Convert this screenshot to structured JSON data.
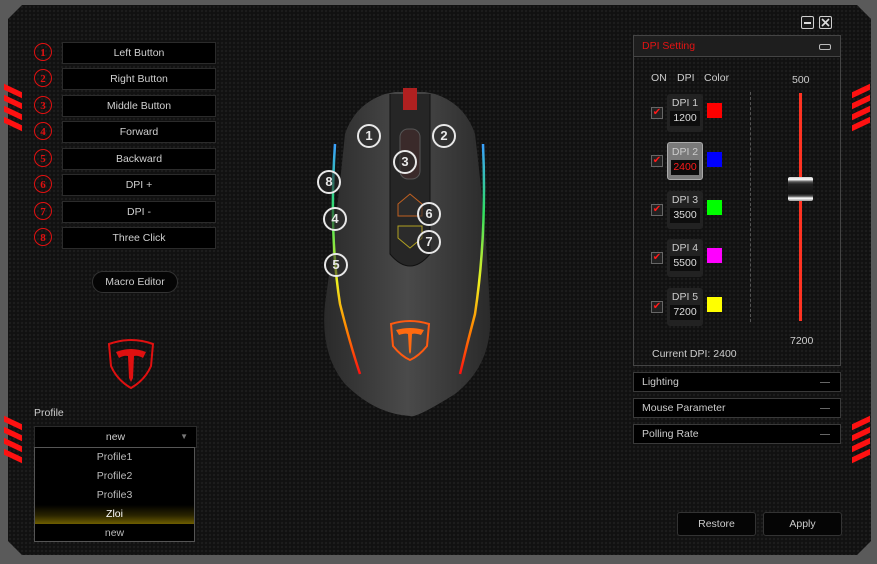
{
  "window": {
    "minimize_icon": "minimize-icon",
    "close_icon": "close-icon"
  },
  "buttons": [
    {
      "num": "1",
      "label": "Left Button"
    },
    {
      "num": "2",
      "label": "Right Button"
    },
    {
      "num": "3",
      "label": "Middle Button"
    },
    {
      "num": "4",
      "label": "Forward"
    },
    {
      "num": "5",
      "label": "Backward"
    },
    {
      "num": "6",
      "label": "DPI +"
    },
    {
      "num": "7",
      "label": "DPI -"
    },
    {
      "num": "8",
      "label": "Three Click"
    }
  ],
  "macro_editor_label": "Macro Editor",
  "profile": {
    "label": "Profile",
    "selected": "new",
    "options": [
      "Profile1",
      "Profile2",
      "Profile3",
      "Zloi",
      "new"
    ],
    "highlighted": "Zloi"
  },
  "mouse_callouts": [
    "1",
    "2",
    "3",
    "4",
    "5",
    "6",
    "7",
    "8"
  ],
  "dpi_setting": {
    "title": "DPI Setting",
    "col_on": "ON",
    "col_dpi": "DPI",
    "col_color": "Color",
    "levels": [
      {
        "name": "DPI 1",
        "value": "1200",
        "on": true,
        "color": "#ff0000"
      },
      {
        "name": "DPI 2",
        "value": "2400",
        "on": true,
        "color": "#0000ff",
        "active": true
      },
      {
        "name": "DPI 3",
        "value": "3500",
        "on": true,
        "color": "#00ff00"
      },
      {
        "name": "DPI 4",
        "value": "5500",
        "on": true,
        "color": "#ff00ff"
      },
      {
        "name": "DPI 5",
        "value": "7200",
        "on": true,
        "color": "#ffff00"
      }
    ],
    "slider_min": "500",
    "slider_max": "7200",
    "current_label": "Current DPI:",
    "current_value": "2400"
  },
  "sections": [
    "Lighting",
    "Mouse Parameter",
    "Polling Rate"
  ],
  "actions": {
    "restore": "Restore",
    "apply": "Apply"
  },
  "check_mark": "✔",
  "dropdown_arrow": "▼",
  "accent_color": "#e31414"
}
